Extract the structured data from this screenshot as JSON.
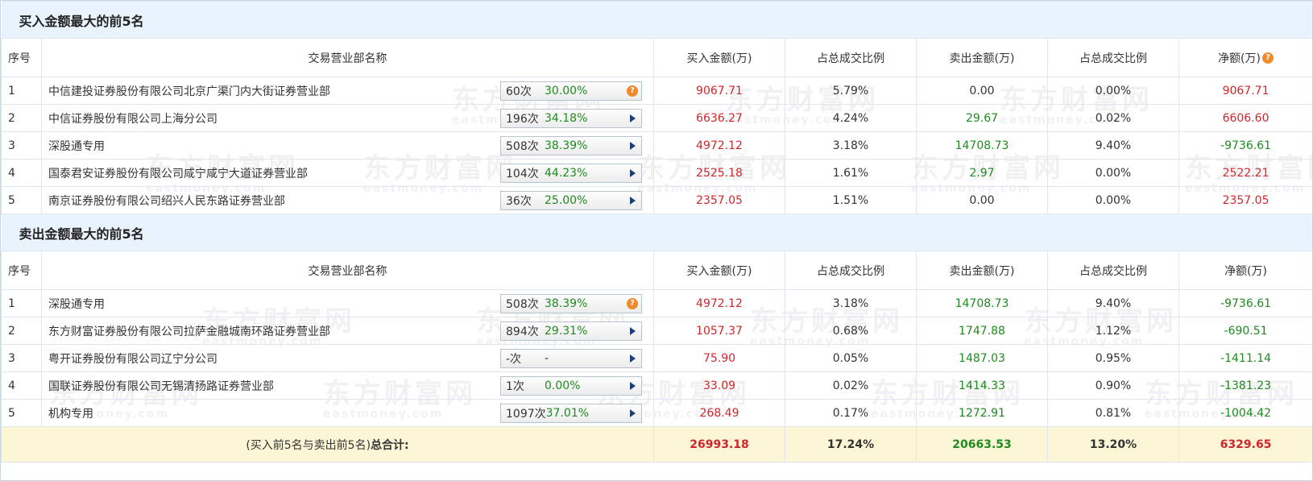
{
  "colors": {
    "red": "#d0262b",
    "green": "#1f8a1f",
    "section_bg": "#e9f3fd",
    "total_bg": "#fdf6d6",
    "question_icon": "#f08a2c"
  },
  "watermark": {
    "text": "东方财富网",
    "sub": "eastmoney.com"
  },
  "columns": {
    "seq": "序号",
    "name": "交易营业部名称",
    "buy": "买入金额(万)",
    "buy_ratio": "占总成交比例",
    "sell": "卖出金额(万)",
    "sell_ratio": "占总成交比例",
    "net": "净额(万)"
  },
  "buy_section": {
    "title": "买入金额最大的前5名",
    "rows": [
      {
        "seq": "1",
        "name": "中信建投证券股份有限公司北京广渠门内大街证券营业部",
        "count": "60次",
        "rate": "30.00%",
        "icon": "question-icon",
        "buy": "9067.71",
        "buy_ratio": "5.79%",
        "sell": "0.00",
        "sell_ratio": "0.00%",
        "net": "9067.71"
      },
      {
        "seq": "2",
        "name": "中信证券股份有限公司上海分公司",
        "count": "196次",
        "rate": "34.18%",
        "icon": "play-icon",
        "buy": "6636.27",
        "buy_ratio": "4.24%",
        "sell": "29.67",
        "sell_ratio": "0.02%",
        "net": "6606.60"
      },
      {
        "seq": "3",
        "name": "深股通专用",
        "count": "508次",
        "rate": "38.39%",
        "icon": "play-icon",
        "buy": "4972.12",
        "buy_ratio": "3.18%",
        "sell": "14708.73",
        "sell_ratio": "9.40%",
        "net": "-9736.61"
      },
      {
        "seq": "4",
        "name": "国泰君安证券股份有限公司咸宁咸宁大道证券营业部",
        "count": "104次",
        "rate": "44.23%",
        "icon": "play-icon",
        "buy": "2525.18",
        "buy_ratio": "1.61%",
        "sell": "2.97",
        "sell_ratio": "0.00%",
        "net": "2522.21"
      },
      {
        "seq": "5",
        "name": "南京证券股份有限公司绍兴人民东路证券营业部",
        "count": "36次",
        "rate": "25.00%",
        "icon": "play-icon",
        "buy": "2357.05",
        "buy_ratio": "1.51%",
        "sell": "0.00",
        "sell_ratio": "0.00%",
        "net": "2357.05"
      }
    ]
  },
  "sell_section": {
    "title": "卖出金额最大的前5名",
    "rows": [
      {
        "seq": "1",
        "name": "深股通专用",
        "count": "508次",
        "rate": "38.39%",
        "icon": "question-icon",
        "buy": "4972.12",
        "buy_ratio": "3.18%",
        "sell": "14708.73",
        "sell_ratio": "9.40%",
        "net": "-9736.61"
      },
      {
        "seq": "2",
        "name": "东方财富证券股份有限公司拉萨金融城南环路证券营业部",
        "count": "894次",
        "rate": "29.31%",
        "icon": "play-icon",
        "buy": "1057.37",
        "buy_ratio": "0.68%",
        "sell": "1747.88",
        "sell_ratio": "1.12%",
        "net": "-690.51"
      },
      {
        "seq": "3",
        "name": "粤开证券股份有限公司辽宁分公司",
        "count": "-次",
        "rate": "-",
        "icon": "play-icon",
        "buy": "75.90",
        "buy_ratio": "0.05%",
        "sell": "1487.03",
        "sell_ratio": "0.95%",
        "net": "-1411.14"
      },
      {
        "seq": "4",
        "name": "国联证券股份有限公司无锡清扬路证券营业部",
        "count": "1次",
        "rate": "0.00%",
        "icon": "play-icon",
        "buy": "33.09",
        "buy_ratio": "0.02%",
        "sell": "1414.33",
        "sell_ratio": "0.90%",
        "net": "-1381.23"
      },
      {
        "seq": "5",
        "name": "机构专用",
        "count": "1097次",
        "rate": "37.01%",
        "icon": "play-icon",
        "buy": "268.49",
        "buy_ratio": "0.17%",
        "sell": "1272.91",
        "sell_ratio": "0.81%",
        "net": "-1004.42"
      }
    ]
  },
  "total": {
    "label_prefix": "(买入前5名与卖出前5名)",
    "label_strong": "总合计:",
    "buy": "26993.18",
    "buy_ratio": "17.24%",
    "sell": "20663.53",
    "sell_ratio": "13.20%",
    "net": "6329.65"
  }
}
